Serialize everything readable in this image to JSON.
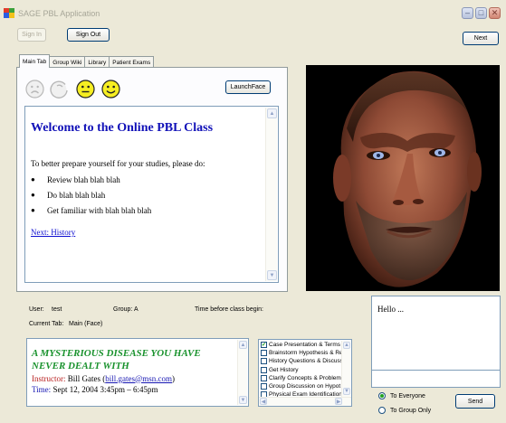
{
  "window": {
    "title": "SAGE PBL Application",
    "minimize_glyph": "–",
    "maximize_glyph": "□",
    "close_glyph": "✕"
  },
  "toolbar": {
    "sign_in_label": "Sign In",
    "sign_out_label": "Sign Out",
    "next_label": "Next"
  },
  "tabs": [
    {
      "label": "Main Tab",
      "active": true
    },
    {
      "label": "Group Wiki",
      "active": false
    },
    {
      "label": "Library",
      "active": false
    },
    {
      "label": "Patient Exams",
      "active": false
    }
  ],
  "face_buttons": [
    {
      "icon": "sad-face-icon"
    },
    {
      "icon": "confused-face-icon"
    },
    {
      "icon": "neutral-face-icon"
    },
    {
      "icon": "happy-face-icon"
    }
  ],
  "launch_face_label": "LaunchFace",
  "document": {
    "heading": "Welcome to the Online PBL Class",
    "intro": "To better prepare yourself for your studies, please do:",
    "bullets": [
      "Review blah blah blah",
      "Do blah blah blah",
      "Get familiar with blah blah blah"
    ],
    "link": "Next: History"
  },
  "status": {
    "user_label": "User:",
    "user_value": "test",
    "group_label": "Group:",
    "group_value": "A",
    "time_label": "Time before class begin:",
    "current_tab_label": "Current Tab:",
    "current_tab_value": "Main (Face)"
  },
  "news": {
    "title": "A MYSTERIOUS DISEASE YOU HAVE NEVER DEALT WITH",
    "instructor_label": "Instructor:",
    "instructor_name": "Bill Gates",
    "instructor_email": "bill.gates@msn.com",
    "time_label": "Time:",
    "time_value": "Sept 12, 2004 3:45pm – 6:45pm"
  },
  "checklist": [
    {
      "label": "Case Presentation & Terms",
      "checked": true
    },
    {
      "label": "Brainstorm Hypothesis & Re",
      "checked": false
    },
    {
      "label": "History Questions & Discuss",
      "checked": false
    },
    {
      "label": "Get History",
      "checked": false
    },
    {
      "label": "Clarify Concepts & Problem",
      "checked": false
    },
    {
      "label": "Group Discussion on Hypot",
      "checked": false
    },
    {
      "label": "Physical Exam Identification",
      "checked": false
    }
  ],
  "chat": {
    "log": "Hello ...",
    "input_value": "",
    "radio_everyone": "To Everyone",
    "radio_group": "To Group Only",
    "everyone_selected": true,
    "send_label": "Send"
  },
  "colors": {
    "heading_blue": "#1111b8",
    "news_green": "#19922d",
    "instructor_red": "#b81f1f"
  }
}
